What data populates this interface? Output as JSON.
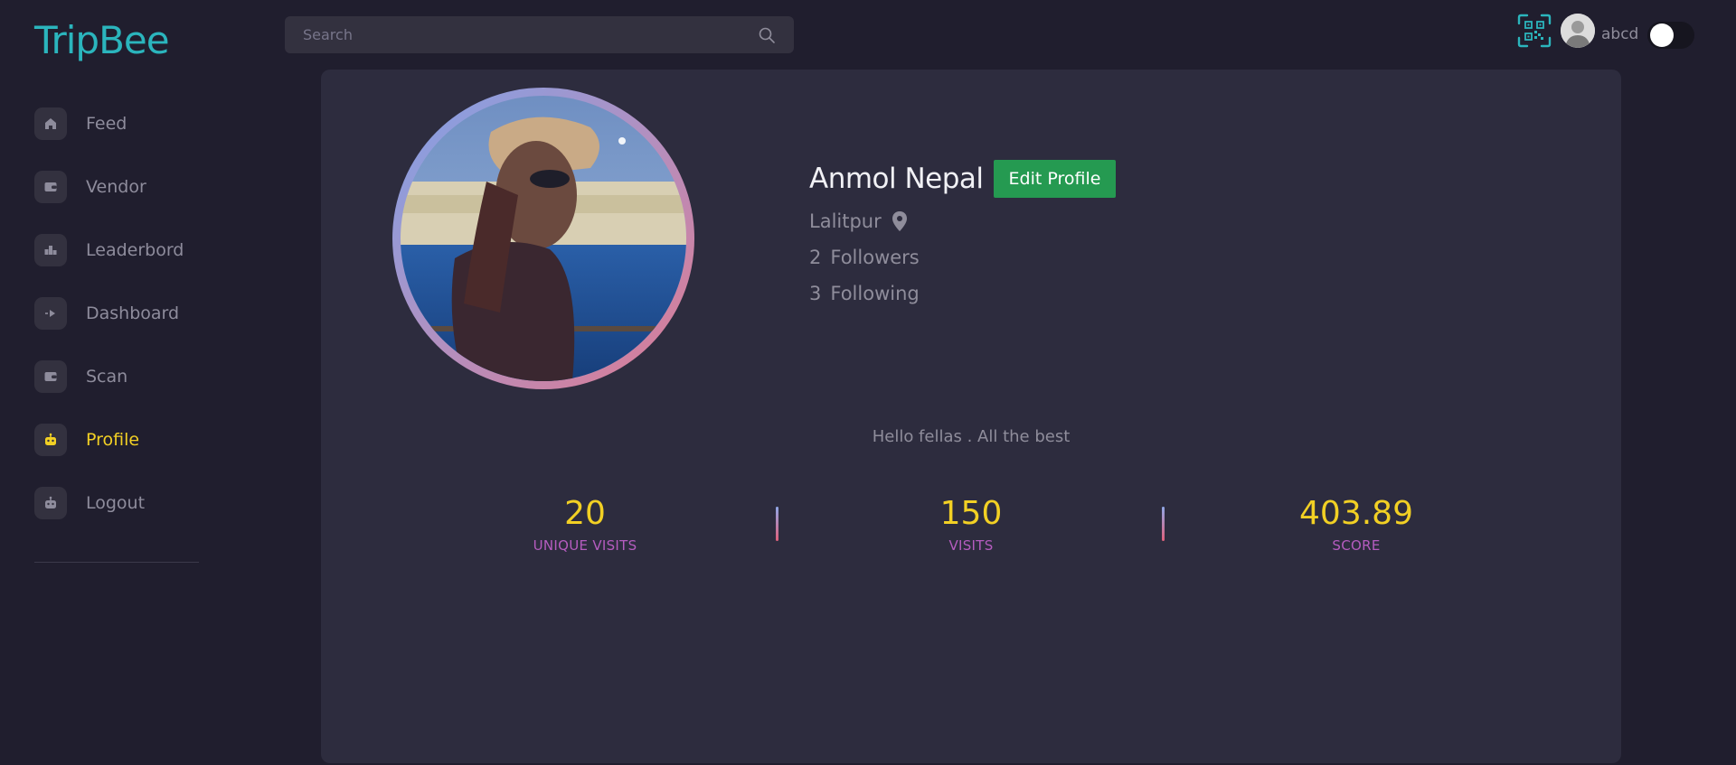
{
  "app": {
    "logo": "TripBee"
  },
  "header": {
    "search_placeholder": "Search",
    "username": "abcd"
  },
  "sidebar": {
    "items": [
      {
        "label": "Feed",
        "icon": "home-icon"
      },
      {
        "label": "Vendor",
        "icon": "wallet-icon"
      },
      {
        "label": "Leaderbord",
        "icon": "leaderboard-icon"
      },
      {
        "label": "Dashboard",
        "icon": "arrow-right-icon"
      },
      {
        "label": "Scan",
        "icon": "wallet-icon"
      },
      {
        "label": "Profile",
        "icon": "robot-icon",
        "active": true
      },
      {
        "label": "Logout",
        "icon": "robot-icon"
      }
    ]
  },
  "profile": {
    "name": "Anmol Nepal",
    "edit_label": "Edit Profile",
    "location": "Lalitpur",
    "followers_count": "2",
    "followers_label": "Followers",
    "following_count": "3",
    "following_label": "Following",
    "bio": "Hello fellas . All the best"
  },
  "stats": [
    {
      "value": "20",
      "label": "UNIQUE VISITS"
    },
    {
      "value": "150",
      "label": "VISITS"
    },
    {
      "value": "403.89",
      "label": "SCORE"
    }
  ],
  "colors": {
    "accent_teal": "#2bb5bd",
    "accent_yellow": "#f2d024",
    "stat_label": "#b55cbf",
    "edit_button": "#259a51",
    "background": "#201e2e",
    "card": "#2d2c3e"
  }
}
